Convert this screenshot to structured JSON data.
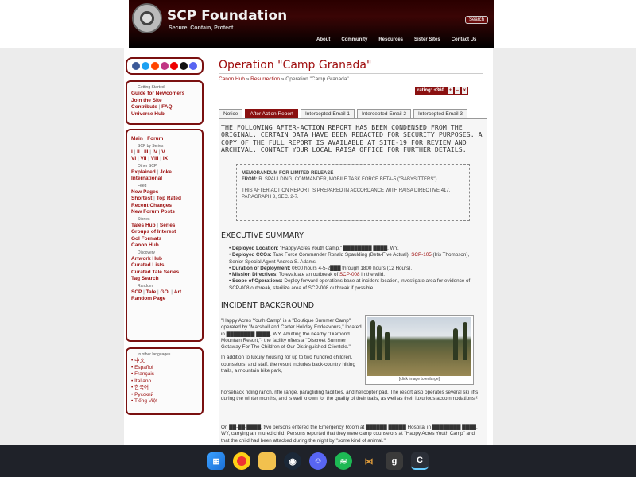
{
  "site": {
    "title": "SCP Foundation",
    "subtitle": "Secure, Contain, Protect",
    "search_label": "Search",
    "nav": [
      "About",
      "Community",
      "Resources",
      "Sister Sites",
      "Contact Us"
    ]
  },
  "social_icons": [
    "facebook-icon",
    "twitter-icon",
    "reddit-icon",
    "instagram-icon",
    "youtube-icon",
    "tiktok-icon",
    "discord-icon"
  ],
  "sidebar": {
    "getting_started": {
      "header": "Getting Started",
      "links": [
        "Guide for Newcomers",
        "Join the Site",
        "Contribute",
        "FAQ",
        "Universe Hub"
      ]
    },
    "main": {
      "main": "Main",
      "forum": "Forum"
    },
    "scp_by_series": {
      "header": "SCP by Series",
      "row1": [
        "I",
        "II",
        "III",
        "IV",
        "V"
      ],
      "row2": [
        "VI",
        "VII",
        "VIII",
        "IX"
      ]
    },
    "other_scp": {
      "header": "Other SCP",
      "links": [
        "Explained",
        "Joke",
        "International"
      ]
    },
    "feed": {
      "header": "Feed",
      "links": [
        "New Pages",
        "Shortest",
        "Top Rated",
        "Recent Changes",
        "New Forum Posts"
      ]
    },
    "stories": {
      "header": "Stories",
      "links": [
        "Tales Hub",
        "Series",
        "Groups of Interest",
        "GoI Formats",
        "Canon Hub"
      ]
    },
    "discovery": {
      "header": "Discovery",
      "links": [
        "Artwork Hub",
        "Curated Lists",
        "Curated Tale Series",
        "Tag Search"
      ]
    },
    "random": {
      "header": "Random",
      "links": [
        "SCP",
        "Tale",
        "GOI",
        "Art",
        "Random Page"
      ]
    },
    "languages": {
      "header": "In other languages",
      "items": [
        "中文",
        "Español",
        "Français",
        "Italiano",
        "한국어",
        "Русский",
        "Tiếng Việt"
      ]
    }
  },
  "page": {
    "title": "Operation \"Camp Granada\"",
    "breadcrumb": {
      "a": "Canon Hub",
      "sep": " » ",
      "b": "Resurrection",
      "current": "Operation \"Camp Granada\""
    },
    "rating": {
      "label": "rating: +360",
      "plus": "+",
      "minus": "–",
      "x": "x"
    },
    "tabs": [
      "Notice",
      "After Action Report",
      "Intercepted Email 1",
      "Intercepted Email 2",
      "Intercepted Email 3"
    ],
    "intro": "THE FOLLOWING AFTER-ACTION REPORT HAS BEEN CONDENSED FROM THE ORIGINAL. CERTAIN DATA HAVE BEEN REDACTED FOR SECURITY PURPOSES. A COPY OF THE FULL REPORT IS AVAILABLE AT SITE-19 FOR REVIEW AND ARCHIVAL. CONTACT YOUR LOCAL RAISA OFFICE FOR FURTHER DETAILS.",
    "memo": {
      "heading": "MEMORANDUM FOR LIMITED RELEASE",
      "from_label": "FROM:",
      "from": " R. SPAULDING, COMMANDER, MOBILE TASK FORCE BETA-5 (\"BABYSITTERS\")",
      "note": "THIS AFTER-ACTION REPORT IS PREPARED IN ACCORDANCE WITH RAISA DIRECTIVE 417, PARAGRAPH 3, SEC. 2-7."
    },
    "exec": {
      "heading": "EXECUTIVE SUMMARY",
      "items": [
        {
          "label": "Deployed Location:",
          "text": " \"Happy Acres Youth Camp,\" ████████ ████, WY."
        },
        {
          "label": "Deployed CCOs:",
          "text": " Task Force Commander Ronald Spaulding (Beta-Five Actual), ",
          "link": "SCP-105",
          "text2": " (Iris Thompson), Senior Special Agent Andrea S. Adams."
        },
        {
          "label": "Duration of Deployment:",
          "text": " 0600 hours 4-5-2███ through 1800 hours (12 Hours)."
        },
        {
          "label": "Mission Directives:",
          "text": " To evaluate an outbreak of ",
          "link": "SCP-008",
          "text2": " in the wild."
        },
        {
          "label": "Scope of Operations:",
          "text": " Deploy forward operations base at incident location, investigate area for evidence of SCP-008 outbreak, sterilize area of SCP-008 outbreak if possible."
        }
      ]
    },
    "incident": {
      "heading": "INCIDENT BACKGROUND",
      "p1": "\"Happy Acres Youth Camp\" is a \"Boutique Summer Camp\" operated by \"Marshall and Carter Holiday Endeavours,\" located in ████████ ████, WY. Abutting the nearby \"Diamond Mountain Resort,\"¹ the facility offers a \"Discreet Summer Getaway For The Children of Our Distinguished Clientele.\"",
      "p2a": "In addition to luxury housing for up to two hundred children, counselors, and staff, the resort includes back-country hiking trails, a mountain bike park,",
      "p2b": "horseback riding ranch, rifle range, paragliding facilities, and helicopter pad. The resort also operates several ski lifts during the winter months, and is well known for the quality of their trails, as well as their luxurious accommodations.²",
      "p3": "On ██-██-████, two persons entered the Emergency Room at ██████ █████ Hospital in ████████ ████, WY, carrying an injured child. Persons reported that they were camp counselors at \"Happy Acres Youth Camp\" and that the child had been attacked during the night by \"some kind of animal.\"",
      "photo_caption": "[click image to enlarge]"
    }
  },
  "taskbar": [
    "windows-start-icon",
    "chrome-icon",
    "file-explorer-icon",
    "steam-icon",
    "discord-icon",
    "spotify-icon",
    "app-icon",
    "g-app-icon",
    "edge-app-icon"
  ],
  "colors": {
    "accent": "#8a1010",
    "link": "#9b0e0e",
    "taskbar": "#1f2229"
  }
}
